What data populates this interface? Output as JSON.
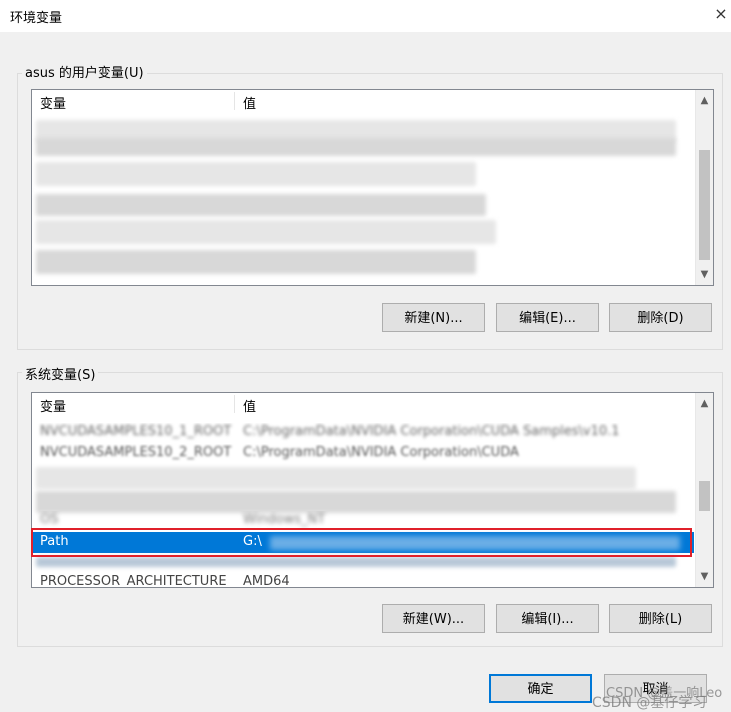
{
  "window": {
    "title": "环境变量",
    "close_icon": "×"
  },
  "user_group": {
    "label": "asus 的用户变量(U)",
    "columns": [
      "变量",
      "值"
    ],
    "buttons": {
      "new": "新建(N)...",
      "edit": "编辑(E)...",
      "delete": "删除(D)"
    }
  },
  "system_group": {
    "label": "系统变量(S)",
    "columns": [
      "变量",
      "值"
    ],
    "rows": [
      {
        "name": "NVCUDASAMPLES10_1_ROOT",
        "value": "C:\\ProgramData\\NVIDIA Corporation\\CUDA Samples\\v10.1"
      },
      {
        "name": "NVCUDASAMPLES10_2_ROOT",
        "value": "C:\\ProgramData\\NVIDIA Corporation\\CUDA"
      },
      {
        "name": "OS",
        "value": "Windows_NT"
      },
      {
        "name": "Path",
        "value": "G:\\"
      },
      {
        "name": "PROCESSOR_ARCHITECTURE",
        "value": "AMD64"
      }
    ],
    "selected_row": "Path",
    "buttons": {
      "new": "新建(W)...",
      "edit": "编辑(I)...",
      "delete": "删除(L)"
    }
  },
  "footer": {
    "ok": "确定",
    "cancel": "取消"
  },
  "watermark": {
    "line1": "CSDN @盖一响Leo",
    "line2": "CSDN @基仔学习"
  },
  "colors": {
    "selection": "#0078d7",
    "highlight_border": "#e0202a"
  }
}
